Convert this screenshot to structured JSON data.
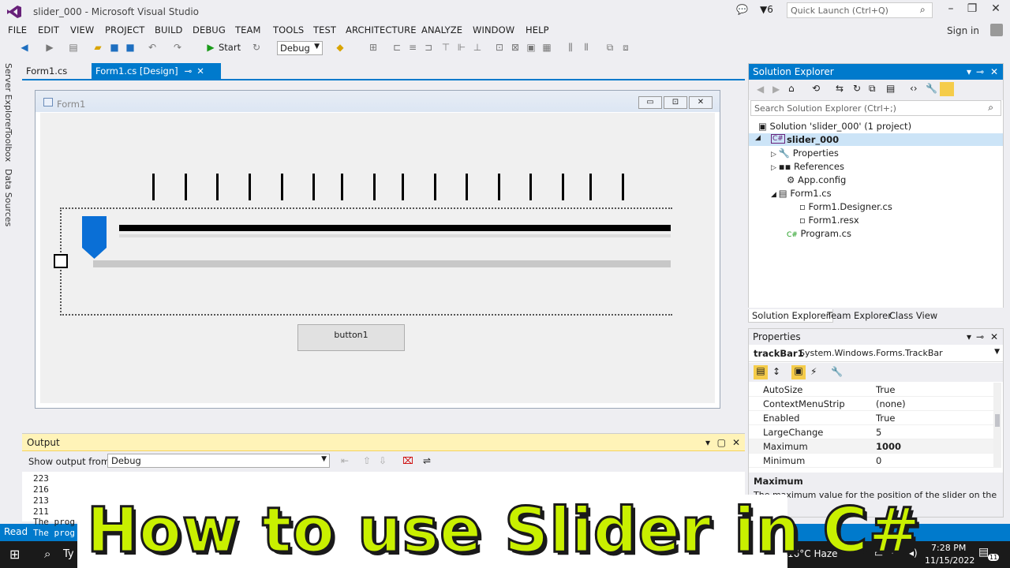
{
  "window": {
    "title": "slider_000 - Microsoft Visual Studio",
    "quick_launch_placeholder": "Quick Launch (Ctrl+Q)",
    "notification_count": "6",
    "sign_in": "Sign in"
  },
  "menu": [
    "FILE",
    "EDIT",
    "VIEW",
    "PROJECT",
    "BUILD",
    "DEBUG",
    "TEAM",
    "TOOLS",
    "TEST",
    "ARCHITECTURE",
    "ANALYZE",
    "WINDOW",
    "HELP"
  ],
  "toolbar": {
    "start_label": "Start",
    "config": "Debug"
  },
  "left_tabs": [
    "Server Explorer",
    "Toolbox",
    "Data Sources"
  ],
  "doc_tabs": [
    {
      "label": "Form1.cs",
      "active": false
    },
    {
      "label": "Form1.cs [Design]",
      "active": true
    }
  ],
  "form": {
    "title": "Form1",
    "button_label": "button1",
    "trackbar_value_fraction": 0.0
  },
  "solution_explorer": {
    "title": "Solution Explorer",
    "search_placeholder": "Search Solution Explorer (Ctrl+;)",
    "tree": [
      "Solution 'slider_000' (1 project)",
      "slider_000",
      "Properties",
      "References",
      "App.config",
      "Form1.cs",
      "Form1.Designer.cs",
      "Form1.resx",
      "Program.cs"
    ],
    "tabs": [
      "Solution Explorer",
      "Team Explorer",
      "Class View"
    ]
  },
  "properties": {
    "title": "Properties",
    "object_name": "trackBar1",
    "object_type": "System.Windows.Forms.TrackBar",
    "rows": [
      {
        "name": "AutoSize",
        "value": "True"
      },
      {
        "name": "ContextMenuStrip",
        "value": "(none)"
      },
      {
        "name": "Enabled",
        "value": "True"
      },
      {
        "name": "LargeChange",
        "value": "5"
      },
      {
        "name": "Maximum",
        "value": "1000"
      },
      {
        "name": "Minimum",
        "value": "0"
      }
    ],
    "desc_title": "Maximum",
    "desc_text": "The maximum value for the position of the slider on the"
  },
  "output": {
    "title": "Output",
    "show_from_label": "Show output from:",
    "show_from_value": "Debug",
    "lines": [
      "223",
      "216",
      "213",
      "211",
      "The prog",
      "The prog"
    ]
  },
  "statusbar": {
    "text": "Read"
  },
  "taskbar": {
    "search": "Ty",
    "weather": "16°C  Haze",
    "time": "7:28 PM",
    "date": "11/15/2022",
    "notif_count": "11"
  },
  "overlay": {
    "headline": "How to use Slider in C#"
  },
  "colors": {
    "accent": "#007acc",
    "slider_thumb": "#0a6fd6",
    "headline": "#c9f000"
  }
}
